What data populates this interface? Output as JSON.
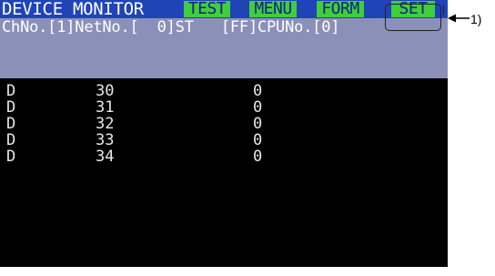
{
  "header": {
    "title": "DEVICE MONITOR",
    "buttons": [
      {
        "label": "TEST",
        "color": "#3fcf3a"
      },
      {
        "label": "MENU",
        "color": "#3fcf3a"
      },
      {
        "label": "FORM",
        "color": "#3fcf3a"
      },
      {
        "label": "SET",
        "color": "#3fcf3a"
      }
    ]
  },
  "info_line": "ChNo.[1]NetNo.[  0]ST   [FF]CPUNo.[0]",
  "rows": [
    {
      "device": "D",
      "number": "30",
      "value": "0"
    },
    {
      "device": "D",
      "number": "31",
      "value": "0"
    },
    {
      "device": "D",
      "number": "32",
      "value": "0"
    },
    {
      "device": "D",
      "number": "33",
      "value": "0"
    },
    {
      "device": "D",
      "number": "34",
      "value": "0"
    }
  ],
  "callout": {
    "label": "1)"
  },
  "colors": {
    "title_bar": "#2044b8",
    "info_bar": "#8a90b8",
    "screen": "#000000",
    "button": "#3fcf3a"
  }
}
